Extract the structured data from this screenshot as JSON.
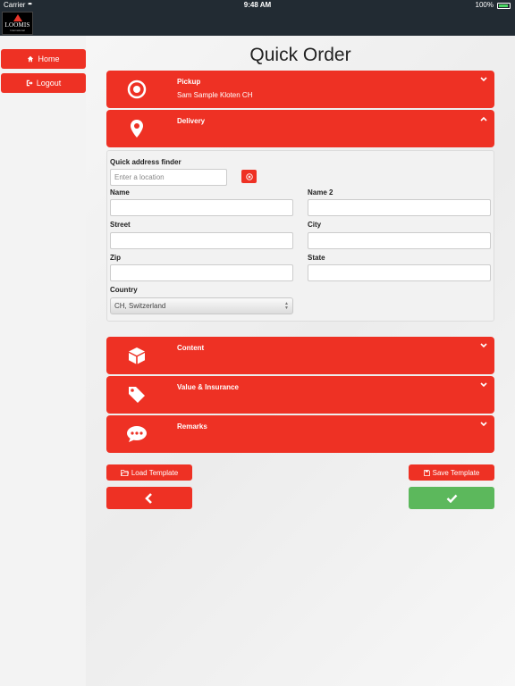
{
  "status_bar": {
    "carrier": "Carrier",
    "time": "9:48 AM",
    "battery": "100%"
  },
  "brand": {
    "name": "LOOMIS",
    "sub": "International"
  },
  "sidebar": {
    "home": "Home",
    "logout": "Logout"
  },
  "page": {
    "title": "Quick Order"
  },
  "sections": {
    "pickup": {
      "title": "Pickup",
      "subtitle": "Sam Sample Kloten CH",
      "icon": "target-icon"
    },
    "delivery": {
      "title": "Delivery",
      "icon": "map-pin-icon"
    },
    "content": {
      "title": "Content",
      "icon": "box-icon"
    },
    "value": {
      "title": "Value & Insurance",
      "icon": "tag-icon"
    },
    "remarks": {
      "title": "Remarks",
      "icon": "speech-bubble-icon"
    }
  },
  "form": {
    "finder_label": "Quick address finder",
    "finder_placeholder": "Enter a location",
    "name_label": "Name",
    "name2_label": "Name 2",
    "street_label": "Street",
    "city_label": "City",
    "zip_label": "Zip",
    "state_label": "State",
    "country_label": "Country",
    "country_value": "CH, Switzerland"
  },
  "buttons": {
    "load_template": "Load Template",
    "save_template": "Save Template"
  },
  "colors": {
    "accent": "#ee3124",
    "confirm": "#5cb85c",
    "nav": "#222b33"
  }
}
